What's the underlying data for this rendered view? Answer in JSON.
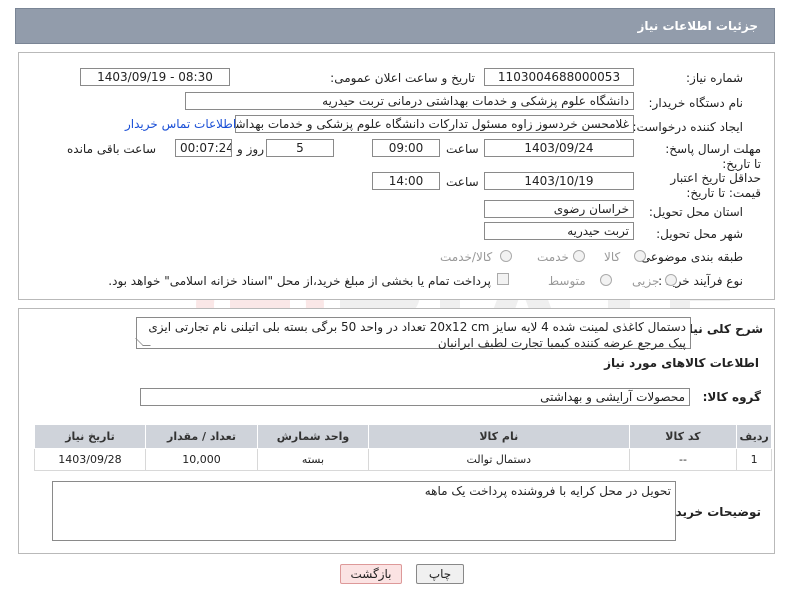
{
  "header": {
    "title": "جزئیات اطلاعات نیاز"
  },
  "form": {
    "need_number_label": "شماره نیاز:",
    "need_number": "1103004688000053",
    "announce_label": "تاریخ و ساعت اعلان عمومی:",
    "announce_value": "1403/09/19 - 08:30",
    "buyer_org_label": "نام دستگاه خریدار:",
    "buyer_org": "دانشگاه علوم پزشکی و خدمات بهداشتی درمانی تربت حیدریه",
    "creator_label": "ایجاد کننده درخواست:",
    "creator": "غلامحسن خردسوز زاوه مسئول تدارکات دانشگاه علوم پزشکی و خدمات بهداشت",
    "contact_link": "اطلاعات تماس خریدار",
    "send_deadline_label": "مهلت ارسال پاسخ: تا تاریخ:",
    "send_deadline_date": "1403/09/24",
    "time_label": "ساعت",
    "send_deadline_time": "09:00",
    "days_value": "5",
    "days_and_label": "روز و",
    "remaining_time": "00:07:24",
    "remaining_label": "ساعت باقی مانده",
    "min_validity_label": "حداقل تاریخ اعتبار قیمت: تا تاریخ:",
    "validity_date": "1403/10/19",
    "validity_time": "14:00",
    "province_label": "استان محل تحویل:",
    "province": "خراسان رضوی",
    "city_label": "شهر محل تحویل:",
    "city": "تربت حیدریه",
    "category_label": "طبقه بندی موضوعی:",
    "category_options": [
      "کالا",
      "خدمت",
      "کالا/خدمت"
    ],
    "purchase_type_label": "نوع فرآیند خرید :",
    "purchase_options": [
      "جزیی",
      "متوسط"
    ],
    "payment_note": "پرداخت تمام یا بخشی از مبلغ خرید،از محل \"اسناد خزانه اسلامی\" خواهد بود."
  },
  "details": {
    "description_label": "شرح کلی نیاز:",
    "description": "دستمال کاغذی لمینت شده 4 لایه سایز 20x12 cm تعداد در واحد 50 برگی بسته بلی اتیلنی نام تجارتی ایزی پیک مرجع عرضه کننده کیمیا تجارت لطیف ایرانیان",
    "goods_info_title": "اطلاعات کالاهای مورد نیاز",
    "goods_group_label": "گروه کالا:",
    "goods_group": "محصولات آرایشی و بهداشتی",
    "table": {
      "headers": [
        "ردیف",
        "کد کالا",
        "نام کالا",
        "واحد شمارش",
        "تعداد / مقدار",
        "تاریخ نیاز"
      ],
      "rows": [
        [
          "1",
          "--",
          "دستمال توالت",
          "بسته",
          "10,000",
          "1403/09/28"
        ]
      ]
    },
    "buyer_notes_label": "توضیحات خریدار:",
    "buyer_notes": "تحویل در محل کرایه با فروشنده پرداخت یک ماهه"
  },
  "buttons": {
    "print": "چاپ",
    "back": "بازگشت"
  },
  "colors": {
    "header_bg": "#929cab",
    "table_header_bg": "#cfd3da",
    "link": "#1a4fd6"
  }
}
